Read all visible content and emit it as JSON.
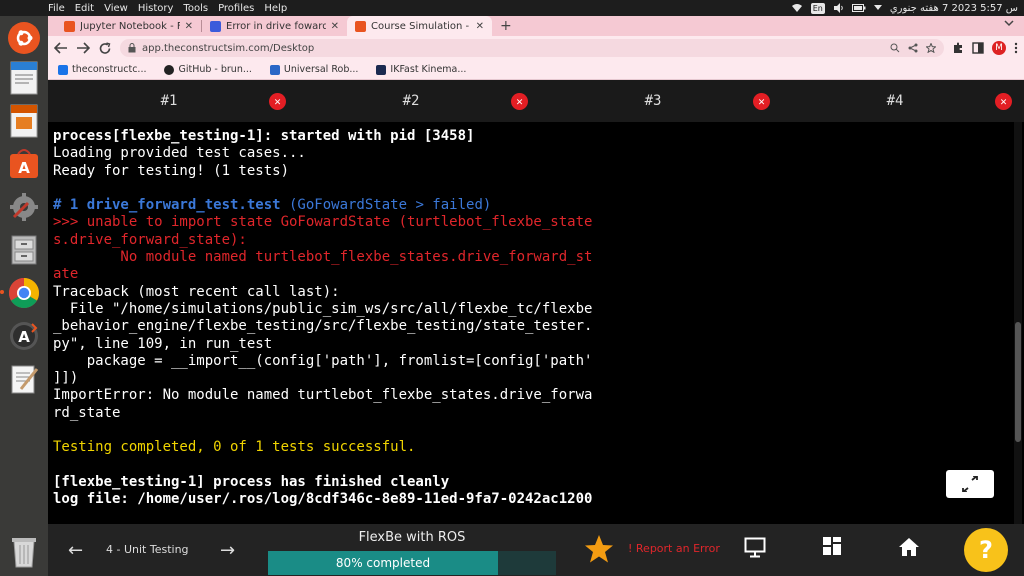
{
  "topbar": {
    "menus": [
      "File",
      "Edit",
      "View",
      "History",
      "Tools",
      "Profiles",
      "Help"
    ],
    "keyboard_layout": "En",
    "clock": "س 5:57 2023 7 هفته جنوري"
  },
  "tabs": [
    {
      "title": "Jupyter Notebook - FlexB",
      "close": "✕",
      "favicon_color": "#e95420"
    },
    {
      "title": "Error in drive foward uni",
      "close": "✕",
      "favicon_color": "#3b5bdb"
    },
    {
      "title": "Course Simulation - FlexB",
      "close": "✕",
      "favicon_color": "#e95420"
    }
  ],
  "new_tab": "+",
  "address": {
    "url": "app.theconstructsim.com/Desktop"
  },
  "profile_initial": "M",
  "bookmarks": [
    {
      "label": "theconstructc...",
      "icon_color": "#1a73e8"
    },
    {
      "label": "GitHub - brun...",
      "icon_color": "#222222"
    },
    {
      "label": "Universal Rob...",
      "icon_color": "#2a66c6"
    },
    {
      "label": "IKFast Kinema...",
      "icon_color": "#1b2a50"
    }
  ],
  "terminal_tabs": [
    {
      "label": "#1",
      "close": "✕"
    },
    {
      "label": "#2",
      "close": "✕"
    },
    {
      "label": "#3",
      "close": "✕"
    },
    {
      "label": "#4",
      "close": "✕"
    }
  ],
  "terminal": {
    "line1": "process[flexbe_testing-1]: started with pid [3458]",
    "line2": "Loading provided test cases...",
    "line3": "Ready for testing! (1 tests)",
    "line5a": "# 1 drive_forward_test.test",
    "line5b": " (GoFowardState > failed)",
    "line6": ">>> unable to import state GoFowardState (turtlebot_flexbe_state",
    "line7": "s.drive_forward_state):",
    "line8": "        No module named turtlebot_flexbe_states.drive_forward_st",
    "line9": "ate",
    "line10": "Traceback (most recent call last):",
    "line11": "  File \"/home/simulations/public_sim_ws/src/all/flexbe_tc/flexbe",
    "line12": "_behavior_engine/flexbe_testing/src/flexbe_testing/state_tester.",
    "line13": "py\", line 109, in run_test",
    "line14": "    package = __import__(config['path'], fromlist=[config['path'",
    "line15": "]])",
    "line16": "ImportError: No module named turtlebot_flexbe_states.drive_forwa",
    "line17": "rd_state",
    "line19": "Testing completed, 0 of 1 tests successful.",
    "line21": "[flexbe_testing-1] process has finished cleanly",
    "line22": "log file: /home/user/.ros/log/8cdf346c-8e89-11ed-9fa7-0242ac1200"
  },
  "course_bar": {
    "prev_arrow": "←",
    "unit_label": "4 - Unit Testing",
    "next_arrow": "→",
    "course_title": "FlexBe with ROS",
    "progress_text": "80% completed",
    "progress_value": 80,
    "report_label": "! Report an Error",
    "help_label": "?"
  },
  "colors": {
    "accent_orange": "#e95420",
    "close_red": "#e31e24",
    "progress_teal": "#1a8c86",
    "help_yellow": "#f8c21a",
    "star_orange": "#f39c12"
  }
}
